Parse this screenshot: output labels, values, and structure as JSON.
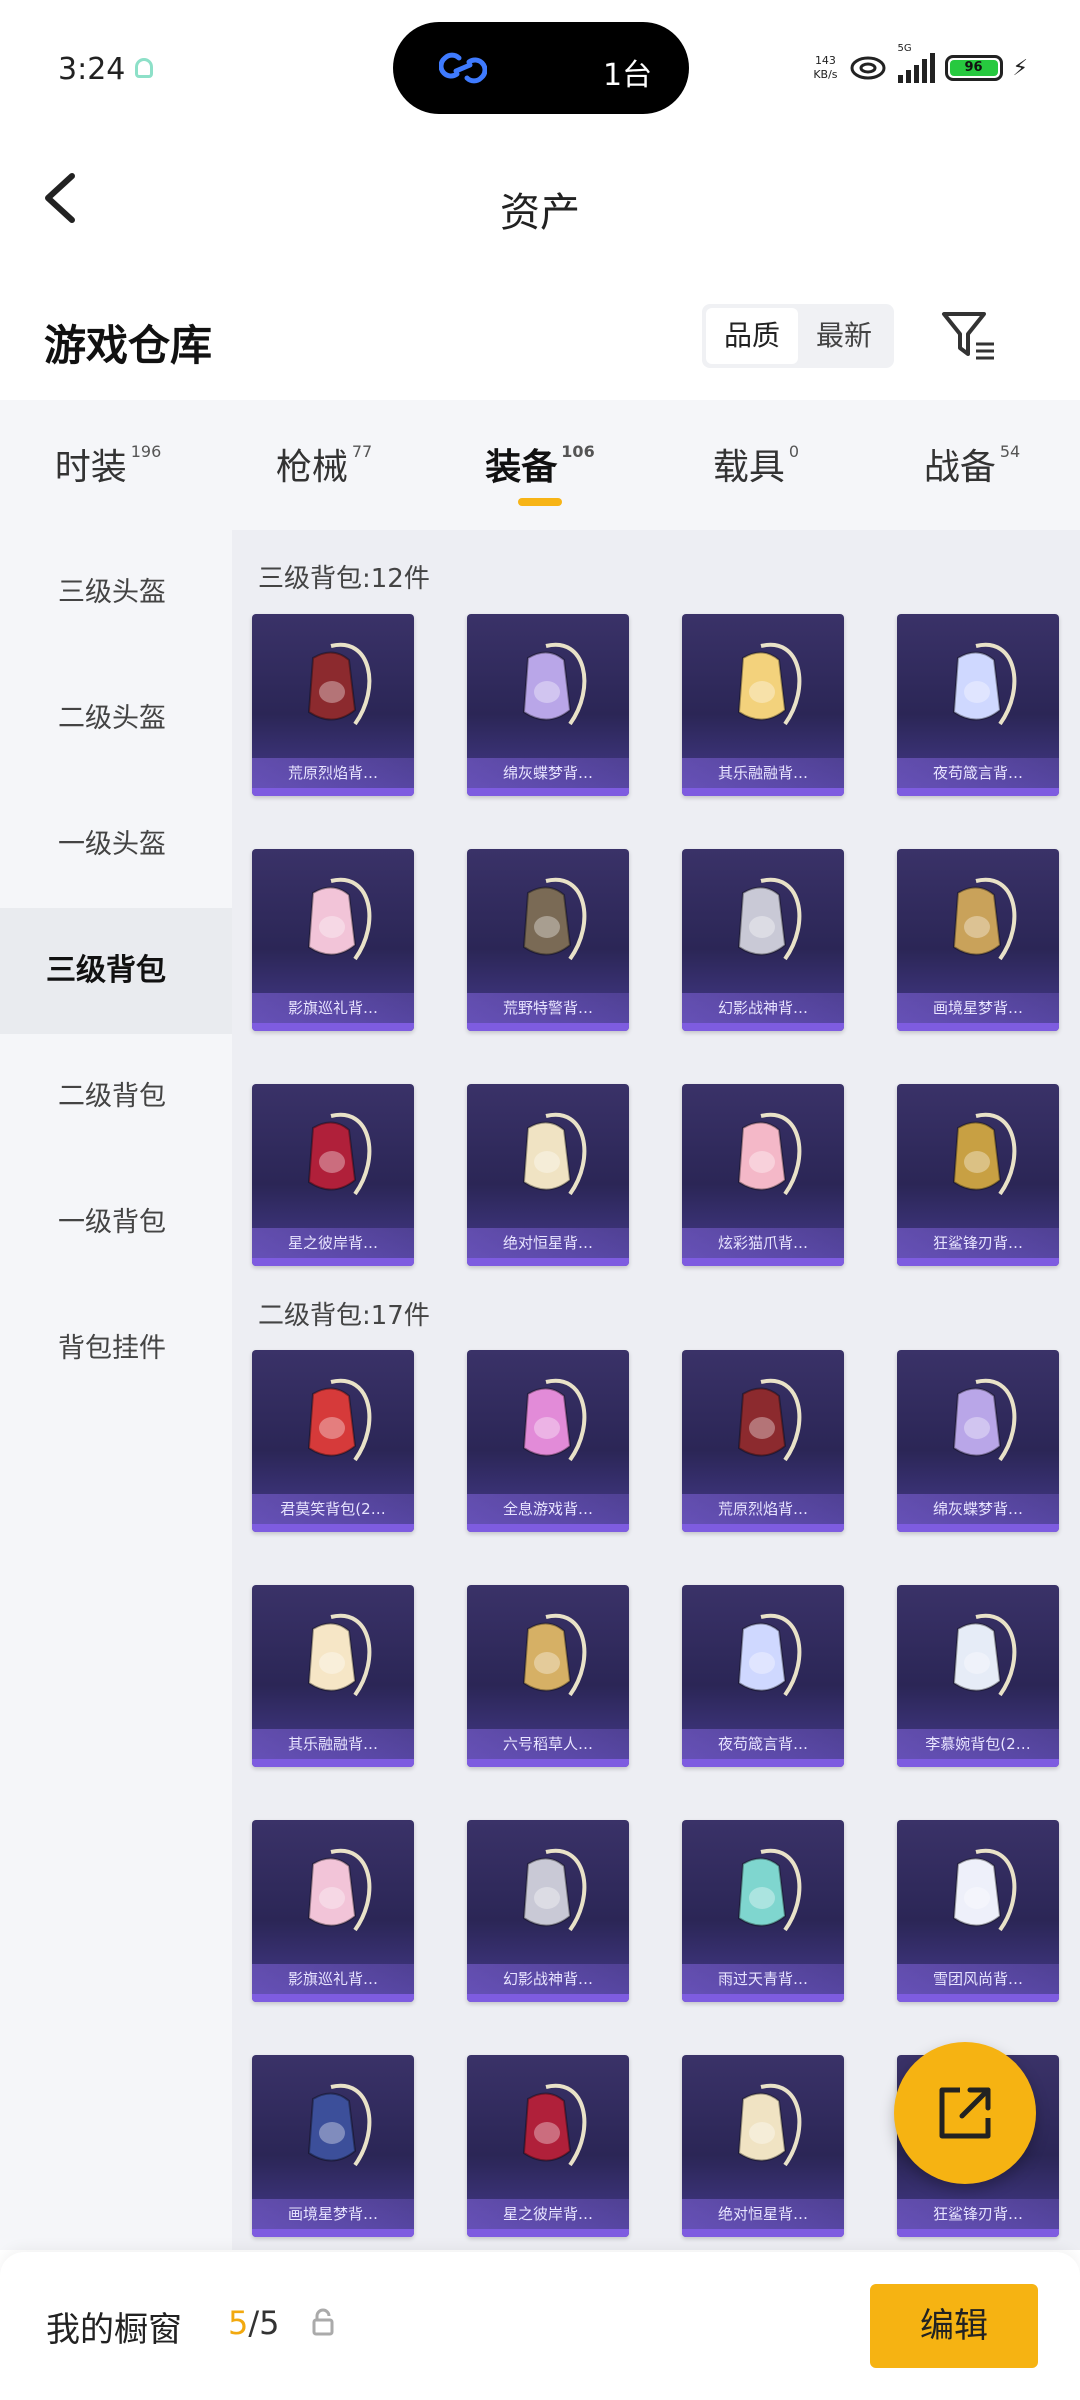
{
  "status_bar": {
    "time": "3:24",
    "island_devices": "1台",
    "net_speed_value": "143",
    "net_speed_unit": "KB/s",
    "network": "5G",
    "battery": "96"
  },
  "header": {
    "title": "资产"
  },
  "warehouse": {
    "title": "游戏仓库",
    "sort_options": [
      "品质",
      "最新"
    ]
  },
  "tabs": [
    {
      "label": "时装",
      "count": "196"
    },
    {
      "label": "枪械",
      "count": "77"
    },
    {
      "label": "装备",
      "count": "106"
    },
    {
      "label": "载具",
      "count": "0"
    },
    {
      "label": "战备",
      "count": "54"
    }
  ],
  "categories": [
    "三级头盔",
    "二级头盔",
    "一级头盔",
    "三级背包",
    "二级背包",
    "一级背包",
    "背包挂件"
  ],
  "sections": [
    {
      "title": "三级背包:12件",
      "items": [
        {
          "name": "荒原烈焰背…",
          "icon": "red-armor-backpack",
          "color": "#8c2a2e"
        },
        {
          "name": "绵灰蝶梦背…",
          "icon": "lilac-crystal-backpack",
          "color": "#b9a6e8"
        },
        {
          "name": "其乐融融背…",
          "icon": "cake-backpack",
          "color": "#f3d27c"
        },
        {
          "name": "夜苟箴言背…",
          "icon": "jellyfish-backpack",
          "color": "#cfd8ff"
        },
        {
          "name": "影旗巡礼背…",
          "icon": "pink-bow-backpack",
          "color": "#f2c4d8"
        },
        {
          "name": "荒野特警背…",
          "icon": "tactical-rucksack",
          "color": "#7a6a55"
        },
        {
          "name": "幻影战神背…",
          "icon": "mecha-backpack",
          "color": "#c9c9d6"
        },
        {
          "name": "画境星梦背…",
          "icon": "mirror-frame-backpack",
          "color": "#c9a25a"
        },
        {
          "name": "星之彼岸背…",
          "icon": "astronaut-backpack",
          "color": "#b0203a"
        },
        {
          "name": "绝对恒星背…",
          "icon": "popcorn-backpack",
          "color": "#f0e3c3"
        },
        {
          "name": "炫彩猫爪背…",
          "icon": "donut-backpack",
          "color": "#f4b8c8"
        },
        {
          "name": "狂鲨锋刃背…",
          "icon": "shark-backpack",
          "color": "#c8a043"
        }
      ]
    },
    {
      "title": "二级背包:17件",
      "items": [
        {
          "name": "君莫笑背包(2…",
          "icon": "red-gem-backpack",
          "color": "#d63a3a"
        },
        {
          "name": "全息游戏背…",
          "icon": "gamepad-backpack",
          "color": "#e28bd8"
        },
        {
          "name": "荒原烈焰背…",
          "icon": "red-armor-backpack",
          "color": "#8c2a2e"
        },
        {
          "name": "绵灰蝶梦背…",
          "icon": "lilac-crystal-backpack",
          "color": "#b9a6e8"
        },
        {
          "name": "其乐融融背…",
          "icon": "cake-backpack",
          "color": "#f6e6c6"
        },
        {
          "name": "六号稻草人…",
          "icon": "scarecrow-backpack",
          "color": "#d6b065"
        },
        {
          "name": "夜苟箴言背…",
          "icon": "jellyfish-backpack",
          "color": "#cfd8ff"
        },
        {
          "name": "李慕婉背包(2…",
          "icon": "white-dress-backpack",
          "color": "#e6ecf7"
        },
        {
          "name": "影旗巡礼背…",
          "icon": "pink-bow-backpack",
          "color": "#f2c4d8"
        },
        {
          "name": "幻影战神背…",
          "icon": "mecha-backpack",
          "color": "#c9c9d6"
        },
        {
          "name": "雨过天青背…",
          "icon": "teal-bird-backpack",
          "color": "#7fd6cf"
        },
        {
          "name": "雪团风尚背…",
          "icon": "snowman-backpack",
          "color": "#eef0fa"
        },
        {
          "name": "画境星梦背…",
          "icon": "book-backpack",
          "color": "#3c4f9a"
        },
        {
          "name": "星之彼岸背…",
          "icon": "astronaut-backpack",
          "color": "#b0203a"
        },
        {
          "name": "绝对恒星背…",
          "icon": "popcorn-backpack",
          "color": "#f0e3c3"
        },
        {
          "name": "狂鲨锋刃背…",
          "icon": "shark-backpack",
          "color": "#c8a043"
        }
      ]
    }
  ],
  "showcase": {
    "title": "我的橱窗",
    "current": "5",
    "total": "/5",
    "edit_label": "编辑"
  }
}
